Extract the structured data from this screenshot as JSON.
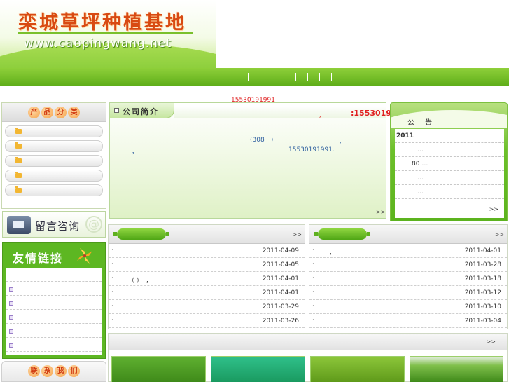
{
  "header": {
    "site_title": "栾城草坪种植基地",
    "site_url": "www.caopingwang.net"
  },
  "colors": {
    "brand_green": "#5db722",
    "accent_red": "#e02020",
    "title_orange": "#d84a12"
  },
  "phone_line": "15530191991",
  "categories": {
    "title_chars": [
      "产",
      "品",
      "分",
      "类"
    ],
    "items": [
      {
        "icon": "folder-icon",
        "label": ""
      },
      {
        "icon": "folder-icon",
        "label": ""
      },
      {
        "icon": "folder-icon",
        "label": ""
      },
      {
        "icon": "folder-icon",
        "label": ""
      },
      {
        "icon": "folder-icon",
        "label": ""
      }
    ]
  },
  "message": {
    "label": "留言咨询",
    "at_symbol": "@"
  },
  "links": {
    "title": "友情链接",
    "items": [
      {
        "icon": "square-bullet-icon"
      },
      {
        "icon": "square-bullet-icon"
      },
      {
        "icon": "square-bullet-icon"
      },
      {
        "icon": "square-bullet-icon"
      },
      {
        "icon": "square-bullet-icon"
      },
      {
        "icon": "square-bullet-icon"
      }
    ]
  },
  "contact": {
    "title_chars": [
      "联",
      "系",
      "我",
      "们"
    ]
  },
  "intro": {
    "tab_label": "公司简介",
    "comma": "，",
    "tel": ":15530191991",
    "text_308": "(308　)",
    "text_comma_a": "，",
    "text_comma_b": "，",
    "text_phone": "15530191991.",
    "more": ">>"
  },
  "notice": {
    "title": "公 告",
    "rows": [
      {
        "dot": "",
        "text": "2011"
      },
      {
        "dot": "·",
        "text": "…"
      },
      {
        "dot": "·",
        "text": "80 …"
      },
      {
        "dot": "·",
        "text": "…"
      },
      {
        "dot": "·",
        "text": "…"
      }
    ],
    "more": ">>"
  },
  "news_left": {
    "more": ">>",
    "rows": [
      {
        "title": "",
        "date": "2011-04-09"
      },
      {
        "title": "",
        "date": "2011-04-05"
      },
      {
        "title": "（ ）　，",
        "date": "2011-04-01"
      },
      {
        "title": "",
        "date": "2011-04-01"
      },
      {
        "title": "",
        "date": "2011-03-29"
      },
      {
        "title": "",
        "date": "2011-03-26"
      }
    ]
  },
  "news_right": {
    "more": ">>",
    "rows": [
      {
        "title": "，",
        "date": "2011-04-01"
      },
      {
        "title": "",
        "date": "2011-03-28"
      },
      {
        "title": "",
        "date": "2011-03-18"
      },
      {
        "title": "",
        "date": "2011-03-12"
      },
      {
        "title": "",
        "date": "2011-03-10"
      },
      {
        "title": "",
        "date": "2011-03-04"
      }
    ]
  },
  "gallery": {
    "more": ">>"
  }
}
